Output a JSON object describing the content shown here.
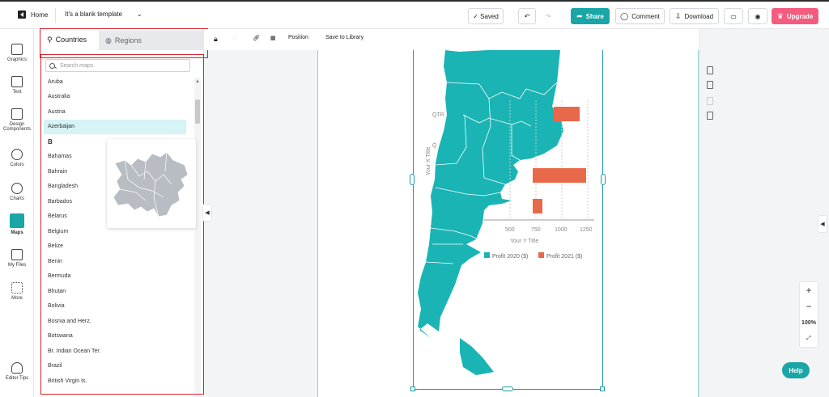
{
  "topbar": {
    "home_label": "Home",
    "template_name": "It's a blank template",
    "saved_label": "✓ Saved",
    "share_label": "Share",
    "comment_label": "Comment",
    "download_label": "Download",
    "upgrade_label": "Upgrade"
  },
  "rail": {
    "graphics": "Graphics",
    "text": "Text",
    "design_components": "Design Components",
    "colors": "Colors",
    "charts": "Charts",
    "maps": "Maps",
    "my_files": "My Files",
    "more": "More",
    "editor_tips": "Editor Tips"
  },
  "panel": {
    "tab_countries": "Countries",
    "tab_regions": "Regions",
    "search_placeholder": "Search maps",
    "section_b": "B",
    "items_a": [
      "Aruba",
      "Australia",
      "Austria",
      "Azerbaijan"
    ],
    "items_b": [
      "Bahamas",
      "Bahrain",
      "Bangladesh",
      "Barbados",
      "Belarus",
      "Belgium",
      "Belize",
      "Benin",
      "Bermuda",
      "Bhutan",
      "Bolivia",
      "Bosnia and Herz.",
      "Botswana",
      "Br. Indian Ocean Ter.",
      "Brazil",
      "British Virgin Is."
    ]
  },
  "objbar": {
    "position": "Position",
    "save_to_library": "Save to Library"
  },
  "chart": {
    "ylabel": "Your X Title",
    "xlabel": "Your Y Title",
    "tick_labels": [
      "500",
      "750",
      "1000",
      "1250"
    ],
    "cat_labels": [
      "QTR",
      "Q"
    ],
    "legend": [
      "Profit 2020 ($)",
      "Profit 2021 ($)"
    ],
    "colors": {
      "teal": "#1ab4b4",
      "orange": "#e8694a"
    }
  },
  "zoom": {
    "plus": "+",
    "minus": "−",
    "level": "100%",
    "fit": "⤢"
  },
  "help_label": "Help",
  "colors": {
    "accent": "#1aa6a6",
    "upgrade": "#f45c7f",
    "highlight": "#d8232a"
  }
}
